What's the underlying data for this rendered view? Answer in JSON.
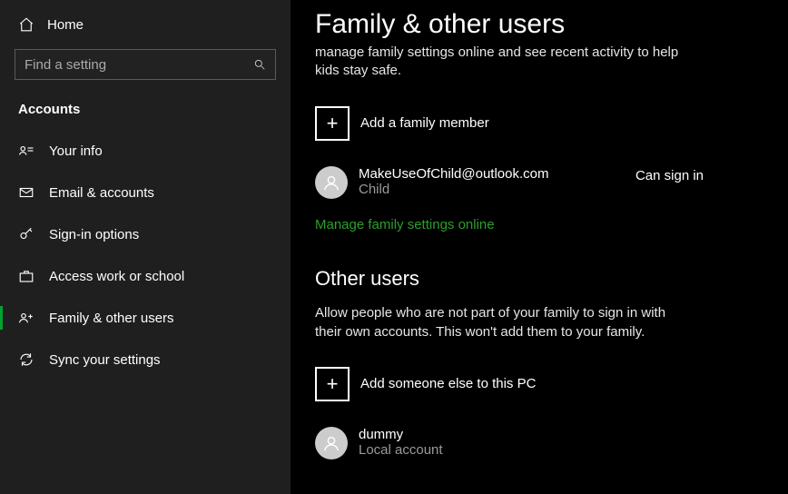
{
  "sidebar": {
    "home_label": "Home",
    "search_placeholder": "Find a setting",
    "section_title": "Accounts",
    "items": [
      {
        "label": "Your info"
      },
      {
        "label": "Email & accounts"
      },
      {
        "label": "Sign-in options"
      },
      {
        "label": "Access work or school"
      },
      {
        "label": "Family & other users"
      },
      {
        "label": "Sync your settings"
      }
    ]
  },
  "main": {
    "title": "Family & other users",
    "family_intro": "manage family settings online and see recent activity to help kids stay safe.",
    "add_family_label": "Add a family member",
    "family_user": {
      "name": "MakeUseOfChild@outlook.com",
      "sub": "Child",
      "status": "Can sign in"
    },
    "manage_link": "Manage family settings online",
    "other_heading": "Other users",
    "other_desc": "Allow people who are not part of your family to sign in with their own accounts. This won't add them to your family.",
    "add_other_label": "Add someone else to this PC",
    "other_user": {
      "name": "dummy",
      "sub": "Local account"
    }
  }
}
